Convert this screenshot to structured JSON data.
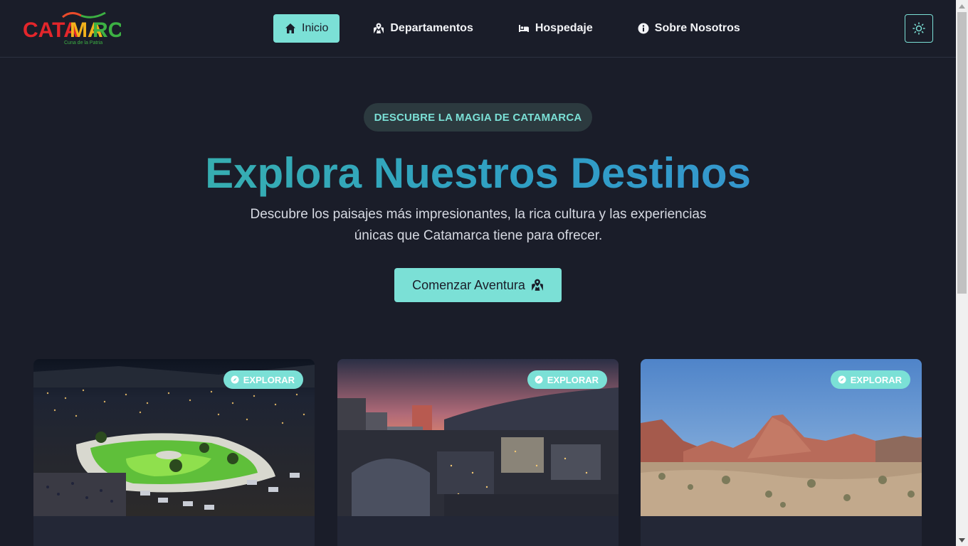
{
  "brand": {
    "logo_text": "CATAMARCA",
    "logo_subtext": "Cuna de la Patria"
  },
  "nav": {
    "items": [
      {
        "label": "Inicio",
        "icon": "home-icon",
        "active": true
      },
      {
        "label": "Departamentos",
        "icon": "map-icon",
        "active": false
      },
      {
        "label": "Hospedaje",
        "icon": "bed-icon",
        "active": false
      },
      {
        "label": "Sobre Nosotros",
        "icon": "info-icon",
        "active": false
      }
    ],
    "theme_toggle_icon": "sun-icon"
  },
  "hero": {
    "badge": "DESCUBRE LA MAGIA DE CATAMARCA",
    "title": "Explora Nuestros Destinos",
    "subtitle_line1": "Descubre los paisajes más impresionantes, la rica cultura y las experiencias",
    "subtitle_line2": "únicas que Catamarca tiene para ofrecer.",
    "cta_label": "Comenzar Aventura",
    "cta_icon": "map-icon"
  },
  "cards": [
    {
      "badge_label": "EXPLORAR",
      "badge_icon": "compass-icon",
      "image": "night-plaza-aerial"
    },
    {
      "badge_label": "EXPLORAR",
      "badge_icon": "compass-icon",
      "image": "city-sunset-skyline"
    },
    {
      "badge_label": "EXPLORAR",
      "badge_icon": "compass-icon",
      "image": "red-mountains-desert"
    }
  ],
  "colors": {
    "background": "#1a1d29",
    "accent": "#7be0d6",
    "title_gradient_start": "#3bb8a4",
    "title_gradient_end": "#3a8fd6"
  }
}
